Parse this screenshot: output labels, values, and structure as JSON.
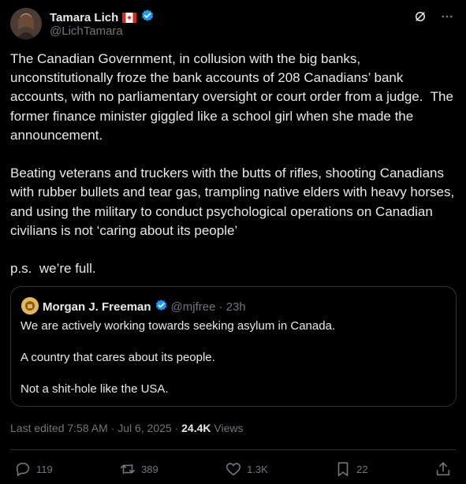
{
  "author": {
    "name": "Tamara Lich",
    "handle": "@LichTamara",
    "flag_icon": "canada-flag-icon"
  },
  "post": {
    "text": "The Canadian Government, in collusion with the big banks, unconstitutionally froze the bank accounts of 208 Canadians’ bank accounts, with no parliamentary oversight or court order from a judge.  The former finance minister giggled like a school girl when she made the announcement.\n\nBeating veterans and truckers with the butts of rifles, shooting Canadians with rubber bullets and tear gas, trampling native elders with heavy horses, and using the military to conduct psychological operations on Canadian civilians is not ‘caring about its people’\n\np.s.  we’re full."
  },
  "quoted": {
    "name": "Morgan J. Freeman",
    "handle": "@mjfree",
    "time": "· 23h",
    "text": "We are actively working towards seeking asylum in Canada.\n\nA country that cares about its people.\n\nNot a shit-hole like the USA."
  },
  "meta": {
    "edited": "Last edited 7:58 AM · Jul 6, 2025 · ",
    "views_count": "24.4K",
    "views_label": " Views"
  },
  "actions": {
    "replies": "119",
    "reposts": "389",
    "likes": "1.3K",
    "bookmarks": "22"
  },
  "colors": {
    "background": "#000000",
    "text": "#e7e9ea",
    "muted": "#71767b",
    "verified": "#1d9bf0",
    "border": "#2f3336"
  }
}
